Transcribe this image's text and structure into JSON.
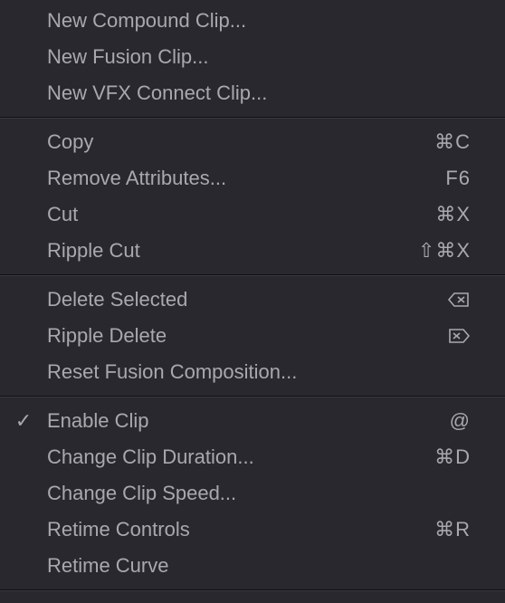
{
  "menu": {
    "groups": [
      {
        "items": [
          {
            "label": "New Compound Clip...",
            "checked": false,
            "shortcut": null,
            "icon": null
          },
          {
            "label": "New Fusion Clip...",
            "checked": false,
            "shortcut": null,
            "icon": null
          },
          {
            "label": "New VFX Connect Clip...",
            "checked": false,
            "shortcut": null,
            "icon": null
          }
        ]
      },
      {
        "items": [
          {
            "label": "Copy",
            "checked": false,
            "shortcut": "⌘C",
            "icon": null
          },
          {
            "label": "Remove Attributes...",
            "checked": false,
            "shortcut": "F6",
            "icon": null
          },
          {
            "label": "Cut",
            "checked": false,
            "shortcut": "⌘X",
            "icon": null
          },
          {
            "label": "Ripple Cut",
            "checked": false,
            "shortcut": "⇧⌘X",
            "icon": null
          }
        ]
      },
      {
        "items": [
          {
            "label": "Delete Selected",
            "checked": false,
            "shortcut": null,
            "icon": "delete-left"
          },
          {
            "label": "Ripple Delete",
            "checked": false,
            "shortcut": null,
            "icon": "delete-right"
          },
          {
            "label": "Reset Fusion Composition...",
            "checked": false,
            "shortcut": null,
            "icon": null
          }
        ]
      },
      {
        "items": [
          {
            "label": "Enable Clip",
            "checked": true,
            "shortcut": "@",
            "icon": null
          },
          {
            "label": "Change Clip Duration...",
            "checked": false,
            "shortcut": "⌘D",
            "icon": null
          },
          {
            "label": "Change Clip Speed...",
            "checked": false,
            "shortcut": null,
            "icon": null
          },
          {
            "label": "Retime Controls",
            "checked": false,
            "shortcut": "⌘R",
            "icon": null
          },
          {
            "label": "Retime Curve",
            "checked": false,
            "shortcut": null,
            "icon": null
          }
        ]
      }
    ]
  }
}
